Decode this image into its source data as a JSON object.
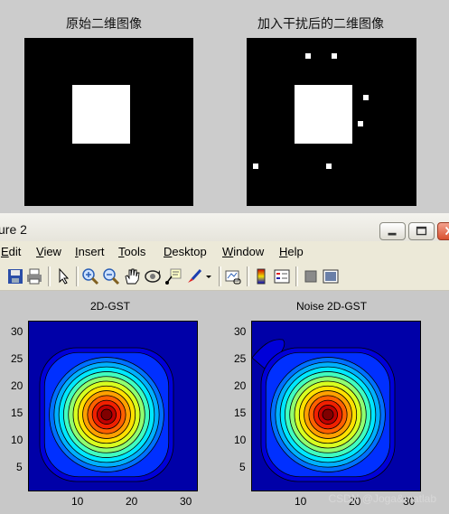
{
  "figure1": {
    "left_title": "原始二维图像",
    "right_title": "加入干扰后的二维图像"
  },
  "window": {
    "title": "ure 2",
    "menu": [
      {
        "label": "Edit",
        "key": "E",
        "rest": "dit"
      },
      {
        "label": "View",
        "key": "V",
        "rest": "iew"
      },
      {
        "label": "Insert",
        "key": "I",
        "rest": "nsert"
      },
      {
        "label": "Tools",
        "key": "T",
        "rest": "ools"
      },
      {
        "label": "Desktop",
        "key": "D",
        "rest": "esktop"
      },
      {
        "label": "Window",
        "key": "W",
        "rest": "indow"
      },
      {
        "label": "Help",
        "key": "H",
        "rest": "elp"
      }
    ],
    "toolbar_icons": [
      "save-icon",
      "print-icon",
      "arrow-pointer-icon",
      "zoom-in-icon",
      "zoom-out-icon",
      "pan-hand-icon",
      "rotate-3d-icon",
      "data-cursor-icon",
      "brush-icon",
      "link-plot-icon",
      "insert-colorbar-icon",
      "insert-legend-icon",
      "hide-plot-tools-icon",
      "show-plot-tools-icon"
    ]
  },
  "figure2": {
    "left_title": "2D-GST",
    "right_title": "Noise 2D-GST",
    "y_ticks": [
      "30",
      "25",
      "20",
      "15",
      "10",
      "5"
    ],
    "x_ticks": [
      "10",
      "20",
      "30"
    ]
  },
  "colors": {
    "figure_bg": "#c8c8c8",
    "jet_dark_blue": "#0000a8",
    "jet_dark_red": "#800000"
  },
  "watermark": "CSDN @Joga&matlab"
}
